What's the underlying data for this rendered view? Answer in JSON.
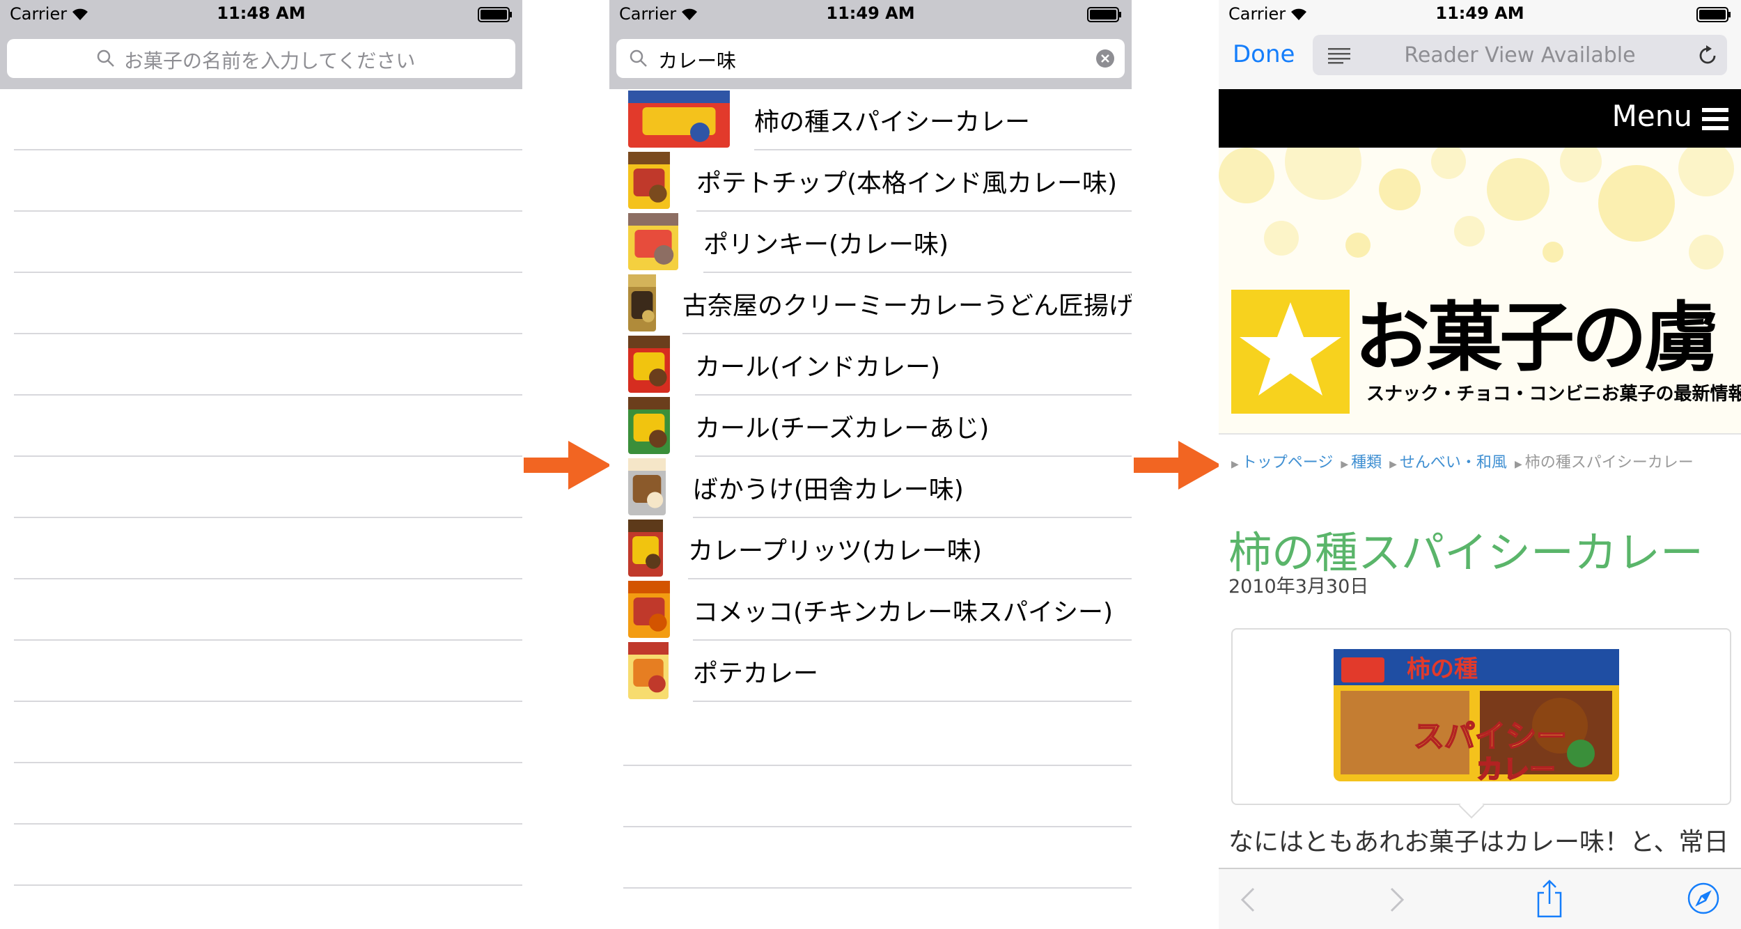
{
  "status": {
    "carrier": "Carrier",
    "time_1": "11:48 AM",
    "time_2": "11:49 AM",
    "time_3": "11:49 AM"
  },
  "screen1": {
    "search_placeholder": "お菓子の名前を入力してください"
  },
  "screen2": {
    "search_value": "カレー味",
    "results": [
      {
        "label": "柿の種スパイシーカレー",
        "icon": "snack-thumbnail",
        "colors": [
          "#e23a2b",
          "#f4c21c",
          "#2f55a6"
        ]
      },
      {
        "label": "ポテトチップ(本格インド風カレー味)",
        "icon": "snack-thumbnail",
        "colors": [
          "#f4c21c",
          "#c0392b",
          "#7a4a1e"
        ]
      },
      {
        "label": "ポリンキー(カレー味)",
        "icon": "snack-thumbnail",
        "colors": [
          "#f4d03f",
          "#e74c3c",
          "#8d6e63"
        ]
      },
      {
        "label": "古奈屋のクリーミーカレーうどん匠揚げ",
        "icon": "snack-thumbnail",
        "colors": [
          "#b08b3a",
          "#3b2a1a",
          "#d4b35a"
        ]
      },
      {
        "label": "カール(インドカレー)",
        "icon": "snack-thumbnail",
        "colors": [
          "#d62d20",
          "#f1c40f",
          "#6b3e1c"
        ]
      },
      {
        "label": "カール(チーズカレーあじ)",
        "icon": "snack-thumbnail",
        "colors": [
          "#3a8f3a",
          "#f1c40f",
          "#6b3e1c"
        ]
      },
      {
        "label": "ばかうけ(田舎カレー味)",
        "icon": "snack-thumbnail",
        "colors": [
          "#bfbfbf",
          "#8b5a2b",
          "#f5e6c8"
        ]
      },
      {
        "label": "カレープリッツ(カレー味)",
        "icon": "snack-thumbnail",
        "colors": [
          "#c0392b",
          "#f1c40f",
          "#5d3a1a"
        ]
      },
      {
        "label": "コメッコ(チキンカレー味スパイシー)",
        "icon": "snack-thumbnail",
        "colors": [
          "#f39c12",
          "#c0392b",
          "#d35400"
        ]
      },
      {
        "label": "ポテカレー",
        "icon": "snack-thumbnail",
        "colors": [
          "#f7dc6f",
          "#e67e22",
          "#c0392b"
        ]
      }
    ]
  },
  "screen3": {
    "done_label": "Done",
    "url_text": "Reader View Available",
    "menu_label": "Menu",
    "logo_text": "お菓子の虜",
    "logo_sub": "スナック・チョコ・コンビニお菓子の最新情報",
    "breadcrumbs": [
      "トップページ",
      "種類",
      "せんべい・和風",
      "柿の種スパイシーカレー"
    ],
    "title": "柿の種スパイシーカレー",
    "date": "2010年3月30日",
    "body": "なにはともあれお菓子はカレー味！と、常日"
  },
  "colors": {
    "arrow": "#f26522",
    "ios_blue": "#157efb",
    "title_green": "#5ab56a",
    "logo_yellow": "#f7d21e"
  }
}
